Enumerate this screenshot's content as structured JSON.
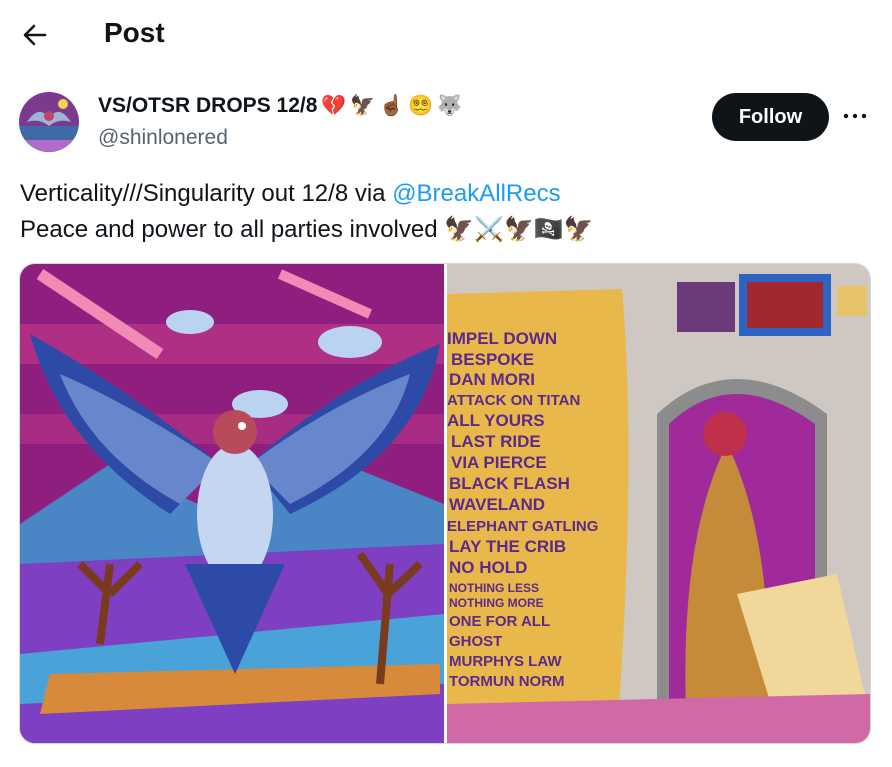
{
  "header": {
    "title": "Post",
    "back_icon": "arrow-left-icon"
  },
  "author": {
    "name": "VS/OTSR DROPS 12/8",
    "name_emojis": [
      "💔",
      "🦅",
      "☝🏾",
      "😵‍💫",
      "🐺"
    ],
    "handle": "@shinlonered",
    "avatar_icon": "avatar-bird-art"
  },
  "actions": {
    "follow_label": "Follow",
    "more_icon": "more-dots-icon"
  },
  "post": {
    "line1_text": "Verticality///Singularity out 12/8 via ",
    "line1_mention": "@BreakAllRecs",
    "line2_text": "Peace and power to all parties involved ",
    "line2_emojis": "🦅⚔️🦅🏴‍☠️🦅"
  },
  "media": {
    "image1_icon": "falcon-artwork-image",
    "image2_icon": "scroll-tracklist-artwork-image",
    "tracklist": [
      "IMPEL DOWN",
      "BESPOKE",
      "DAN MORI",
      "ATTACK ON TITAN",
      "ALL YOURS",
      "LAST RIDE",
      "VIA PIERCE",
      "BLACK FLASH",
      "WAVELAND",
      "ELEPHANT GATLING",
      "LAY THE CRIB",
      "NO HOLD",
      "NOTHING LESS",
      "NOTHING MORE",
      "ONE FOR ALL",
      "GHOST",
      "MURPHYS LAW",
      "TORMUN NORM"
    ]
  },
  "colors": {
    "accent": "#1d9bf0",
    "text": "#0f1419",
    "muted": "#536471",
    "button": "#0f1419"
  }
}
